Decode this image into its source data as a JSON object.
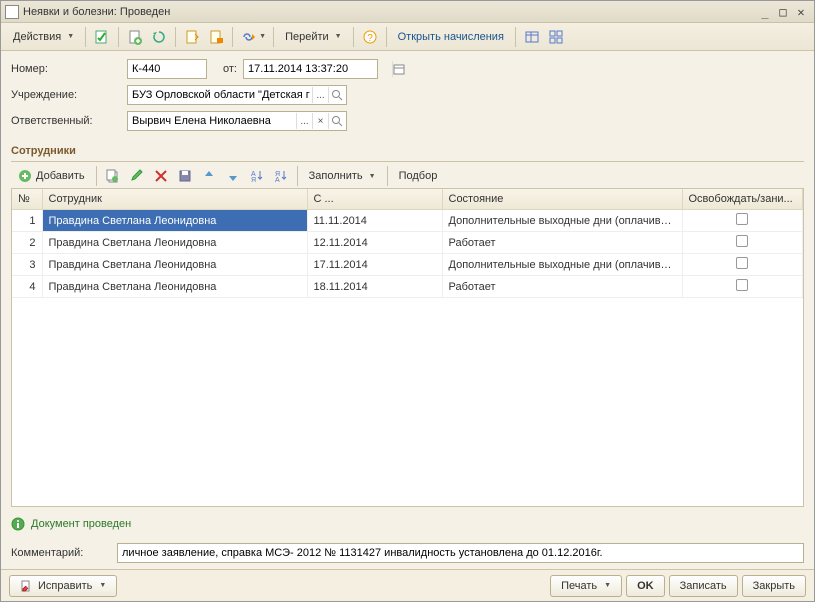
{
  "window": {
    "title": "Неявки и болезни: Проведен"
  },
  "toolbar": {
    "actions": "Действия",
    "go": "Перейти",
    "open_calc": "Открыть начисления"
  },
  "form": {
    "number_label": "Номер:",
    "number_value": "К-440",
    "from_label": "от:",
    "date_value": "17.11.2014 13:37:20",
    "org_label": "Учреждение:",
    "org_value": "БУЗ Орловской области \"Детская г",
    "resp_label": "Ответственный:",
    "resp_value": "Вырвич Елена Николаевна"
  },
  "employees": {
    "section_title": "Сотрудники",
    "add_label": "Добавить",
    "fill_label": "Заполнить",
    "select_label": "Подбор",
    "columns": {
      "num": "№",
      "employee": "Сотрудник",
      "from": "С ...",
      "state": "Состояние",
      "release": "Освобождать/зани..."
    },
    "rows": [
      {
        "n": "1",
        "emp": "Правдина Светлана Леонидовна",
        "from": "11.11.2014",
        "state": "Дополнительные выходные дни (оплачивае...",
        "rel": false,
        "selected": true
      },
      {
        "n": "2",
        "emp": "Правдина Светлана Леонидовна",
        "from": "12.11.2014",
        "state": "Работает",
        "rel": false
      },
      {
        "n": "3",
        "emp": "Правдина Светлана Леонидовна",
        "from": "17.11.2014",
        "state": "Дополнительные выходные дни (оплачивае...",
        "rel": false
      },
      {
        "n": "4",
        "emp": "Правдина Светлана Леонидовна",
        "from": "18.11.2014",
        "state": "Работает",
        "rel": false
      }
    ]
  },
  "status": {
    "text": "Документ проведен"
  },
  "comment": {
    "label": "Комментарий:",
    "value": "личное заявление, справка МСЭ- 2012 № 1131427 инвалидность установлена до 01.12.2016г."
  },
  "footer": {
    "fix": "Исправить",
    "print": "Печать",
    "ok": "OK",
    "write": "Записать",
    "close": "Закрыть"
  }
}
